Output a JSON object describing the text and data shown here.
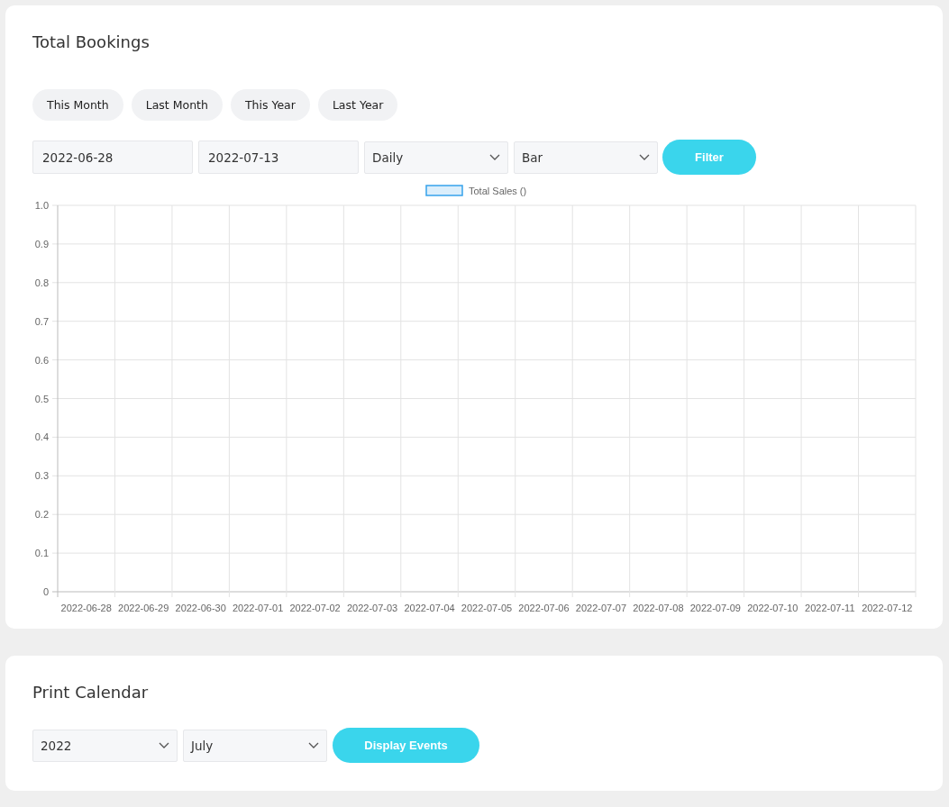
{
  "bookings": {
    "title": "Total Bookings",
    "quick_ranges": [
      {
        "label": "This Month"
      },
      {
        "label": "Last Month"
      },
      {
        "label": "This Year"
      },
      {
        "label": "Last Year"
      }
    ],
    "start_date": {
      "value": "2022-06-28"
    },
    "end_date": {
      "value": "2022-07-13"
    },
    "interval_select": {
      "value": "Daily"
    },
    "chart_type_select": {
      "value": "Bar"
    },
    "filter_button": "Filter",
    "chart_data": {
      "type": "bar",
      "grid": true,
      "categories": [
        "2022-06-28",
        "2022-06-29",
        "2022-06-30",
        "2022-07-01",
        "2022-07-02",
        "2022-07-03",
        "2022-07-04",
        "2022-07-05",
        "2022-07-06",
        "2022-07-07",
        "2022-07-08",
        "2022-07-09",
        "2022-07-10",
        "2022-07-11",
        "2022-07-12"
      ],
      "series": [
        {
          "name": "Total Sales ()",
          "color": "#36a2eb",
          "values": [
            null,
            null,
            null,
            null,
            null,
            null,
            null,
            null,
            null,
            null,
            null,
            null,
            null,
            null,
            null
          ]
        }
      ],
      "ylim": [
        0,
        1
      ],
      "yticks": [
        {
          "value": 0,
          "label": "0"
        },
        {
          "value": 0.1,
          "label": "0.1"
        },
        {
          "value": 0.2,
          "label": "0.2"
        },
        {
          "value": 0.3,
          "label": "0.3"
        },
        {
          "value": 0.4,
          "label": "0.4"
        },
        {
          "value": 0.5,
          "label": "0.5"
        },
        {
          "value": 0.6,
          "label": "0.6"
        },
        {
          "value": 0.7,
          "label": "0.7"
        },
        {
          "value": 0.8,
          "label": "0.8"
        },
        {
          "value": 0.9,
          "label": "0.9"
        },
        {
          "value": 1,
          "label": "1.0"
        }
      ]
    }
  },
  "print_calendar": {
    "title": "Print Calendar",
    "year_select": {
      "value": "2022"
    },
    "month_select": {
      "value": "July"
    },
    "button": "Display Events"
  }
}
